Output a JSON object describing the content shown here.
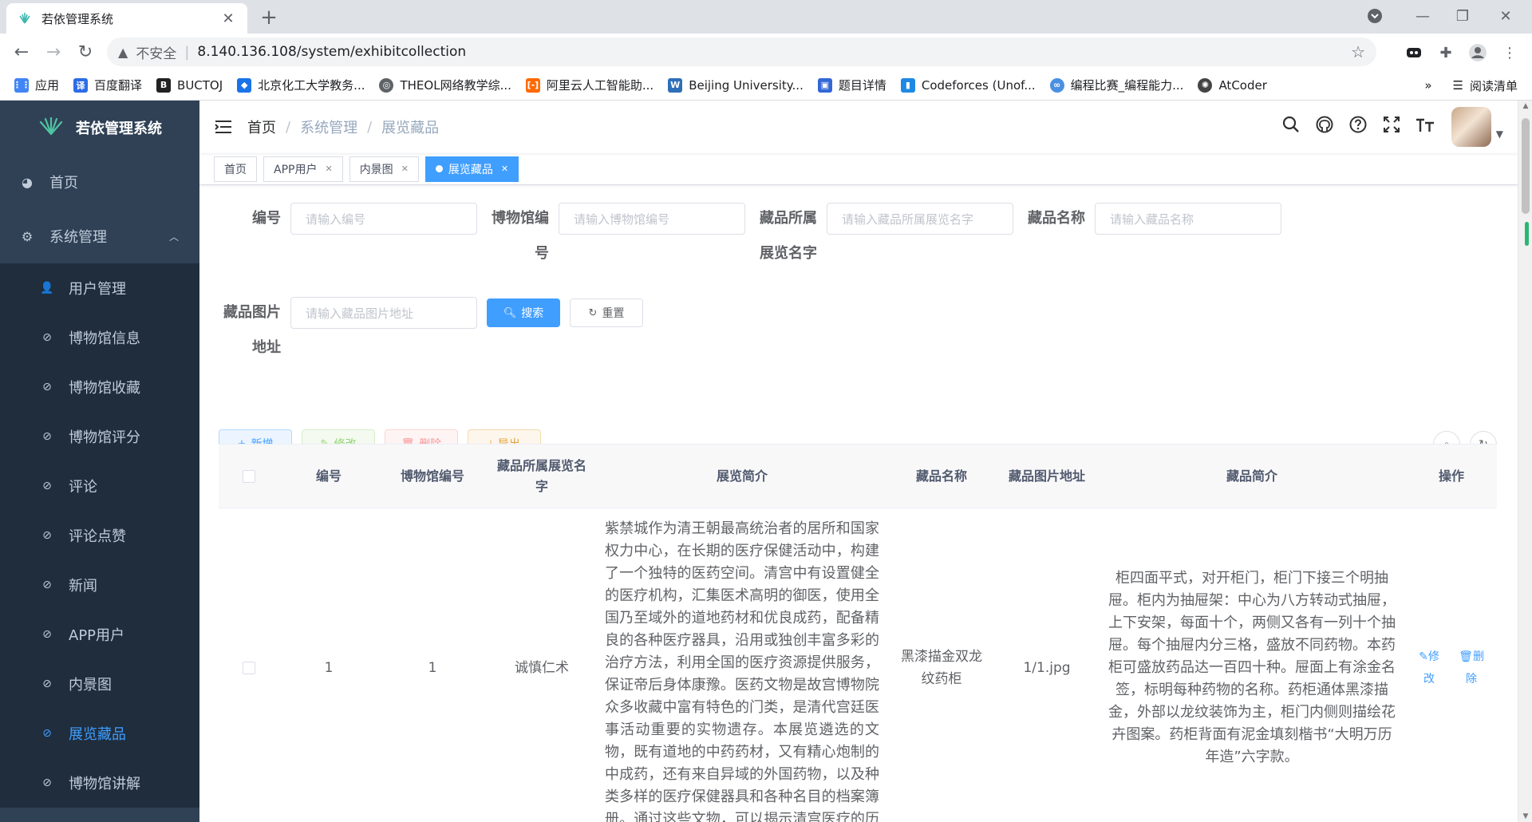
{
  "browser": {
    "tab_title": "若依管理系统",
    "insecure_label": "不安全",
    "url": "8.140.136.108/system/exhibitcollection",
    "bookmarks": [
      {
        "label": "应用",
        "color": "#4285f4",
        "icon": "apps-grid-icon"
      },
      {
        "label": "百度翻译",
        "color": "#2d6ce6",
        "icon": "baidu-translate-icon"
      },
      {
        "label": "BUCTOJ",
        "color": "#222222",
        "icon": "buctoj-icon"
      },
      {
        "label": "北京化工大学教务...",
        "color": "#1a73e8",
        "icon": "buct-icon"
      },
      {
        "label": "THEOL网络教学综...",
        "color": "#5f6368",
        "icon": "globe-icon"
      },
      {
        "label": "阿里云人工智能助...",
        "color": "#ff6a00",
        "icon": "aliyun-icon"
      },
      {
        "label": "Beijing University...",
        "color": "#2f6fb8",
        "icon": "buct-site-icon"
      },
      {
        "label": "题目详情",
        "color": "#3367d6",
        "icon": "problem-detail-icon"
      },
      {
        "label": "Codeforces (Unof...",
        "color": "#1e88e5",
        "icon": "codeforces-icon"
      },
      {
        "label": "编程比赛_编程能力...",
        "color": "#4a90e2",
        "icon": "contest-icon"
      },
      {
        "label": "AtCoder",
        "color": "#444444",
        "icon": "atcoder-icon"
      }
    ],
    "more_label": "»",
    "reading_list": "阅读清单"
  },
  "sidebar": {
    "title": "若依管理系统",
    "home": "首页",
    "system": "系统管理",
    "items": [
      {
        "label": "用户管理",
        "name": "sidebar-item-user-management",
        "icon": "user-icon"
      },
      {
        "label": "博物馆信息",
        "name": "sidebar-item-museum-info",
        "icon": "circle-check-icon"
      },
      {
        "label": "博物馆收藏",
        "name": "sidebar-item-museum-collection",
        "icon": "circle-check-icon"
      },
      {
        "label": "博物馆评分",
        "name": "sidebar-item-museum-rating",
        "icon": "circle-check-icon"
      },
      {
        "label": "评论",
        "name": "sidebar-item-comment",
        "icon": "circle-check-icon"
      },
      {
        "label": "评论点赞",
        "name": "sidebar-item-comment-like",
        "icon": "circle-check-icon"
      },
      {
        "label": "新闻",
        "name": "sidebar-item-news",
        "icon": "circle-check-icon"
      },
      {
        "label": "APP用户",
        "name": "sidebar-item-app-user",
        "icon": "circle-check-icon"
      },
      {
        "label": "内景图",
        "name": "sidebar-item-interior-image",
        "icon": "circle-check-icon"
      },
      {
        "label": "展览藏品",
        "name": "sidebar-item-exhibit-collection",
        "icon": "circle-check-icon",
        "active": true
      },
      {
        "label": "博物馆讲解",
        "name": "sidebar-item-museum-guide",
        "icon": "circle-check-icon"
      }
    ]
  },
  "breadcrumb": [
    "首页",
    "系统管理",
    "展览藏品"
  ],
  "tags": [
    {
      "label": "首页",
      "closable": false
    },
    {
      "label": "APP用户",
      "closable": true
    },
    {
      "label": "内景图",
      "closable": true
    },
    {
      "label": "展览藏品",
      "closable": true,
      "active": true
    }
  ],
  "search": {
    "id_label": "编号",
    "id_placeholder": "请输入编号",
    "museum_label": "博物馆编号",
    "museum_placeholder": "请输入博物馆编号",
    "exhibit_label": "藏品所属展览名字",
    "exhibit_placeholder": "请输入藏品所属展览名字",
    "name_label": "藏品名称",
    "name_placeholder": "请输入藏品名称",
    "image_label": "藏品图片地址",
    "image_placeholder": "请输入藏品图片地址",
    "search_btn": "搜索",
    "reset_btn": "重置"
  },
  "actions": {
    "add": "新增",
    "edit": "修改",
    "delete": "删除",
    "export": "导出"
  },
  "table": {
    "headers": [
      "编号",
      "博物馆编号",
      "藏品所属展览名字",
      "展览简介",
      "藏品名称",
      "藏品图片地址",
      "藏品简介",
      "操作"
    ],
    "rows": [
      {
        "id": "1",
        "museum_id": "1",
        "exhibit": "诚慎仁术",
        "exhibit_desc": "紫禁城作为清王朝最高统治者的居所和国家权力中心，在长期的医疗保健活动中，构建了一个独特的医药空间。清宫中有设置健全的医疗机构，汇集医术高明的御医，使用全国乃至域外的道地药材和优良成药，配备精良的各种医疗器具，沿用或独创丰富多彩的治疗方法，利用全国的医疗资源提供服务，保证帝后身体康豫。医药文物是故宫博物院众多收藏中富有特色的门类，是清代宫廷医事活动重要的实物遗存。本展览遴选的文物，既有道地的中药药材，又有精心炮制的中成药，还有来自异域的外国药物，以及种类多样的医疗保健器具和各种名目的档案簿册。通过这些文物，可以揭示清宫医疗的历史状况，进而窥见清代宫廷生活",
        "name": "黑漆描金双龙纹药柜",
        "image": "1/1.jpg",
        "intro": "柜四面平式，对开柜门，柜门下接三个明抽屉。柜内为抽屉架：中心为八方转动式抽屉，上下安架，每面十个，两侧又各有一列十个抽屉。每个抽屉内分三格，盛放不同药物。本药柜可盛放药品达一百四十种。屉面上有涂金名签，标明每种药物的名称。药柜通体黑漆描金，外部以龙纹装饰为主，柜门内侧则描绘花卉图案。药柜背面有泥金填刻楷书“大明万历年造”六字款。",
        "op_edit": "修改",
        "op_delete": "删除"
      }
    ]
  },
  "colors": {
    "sidebar_bg": "#304156",
    "primary": "#409eff",
    "active_menu": "#409eff"
  }
}
